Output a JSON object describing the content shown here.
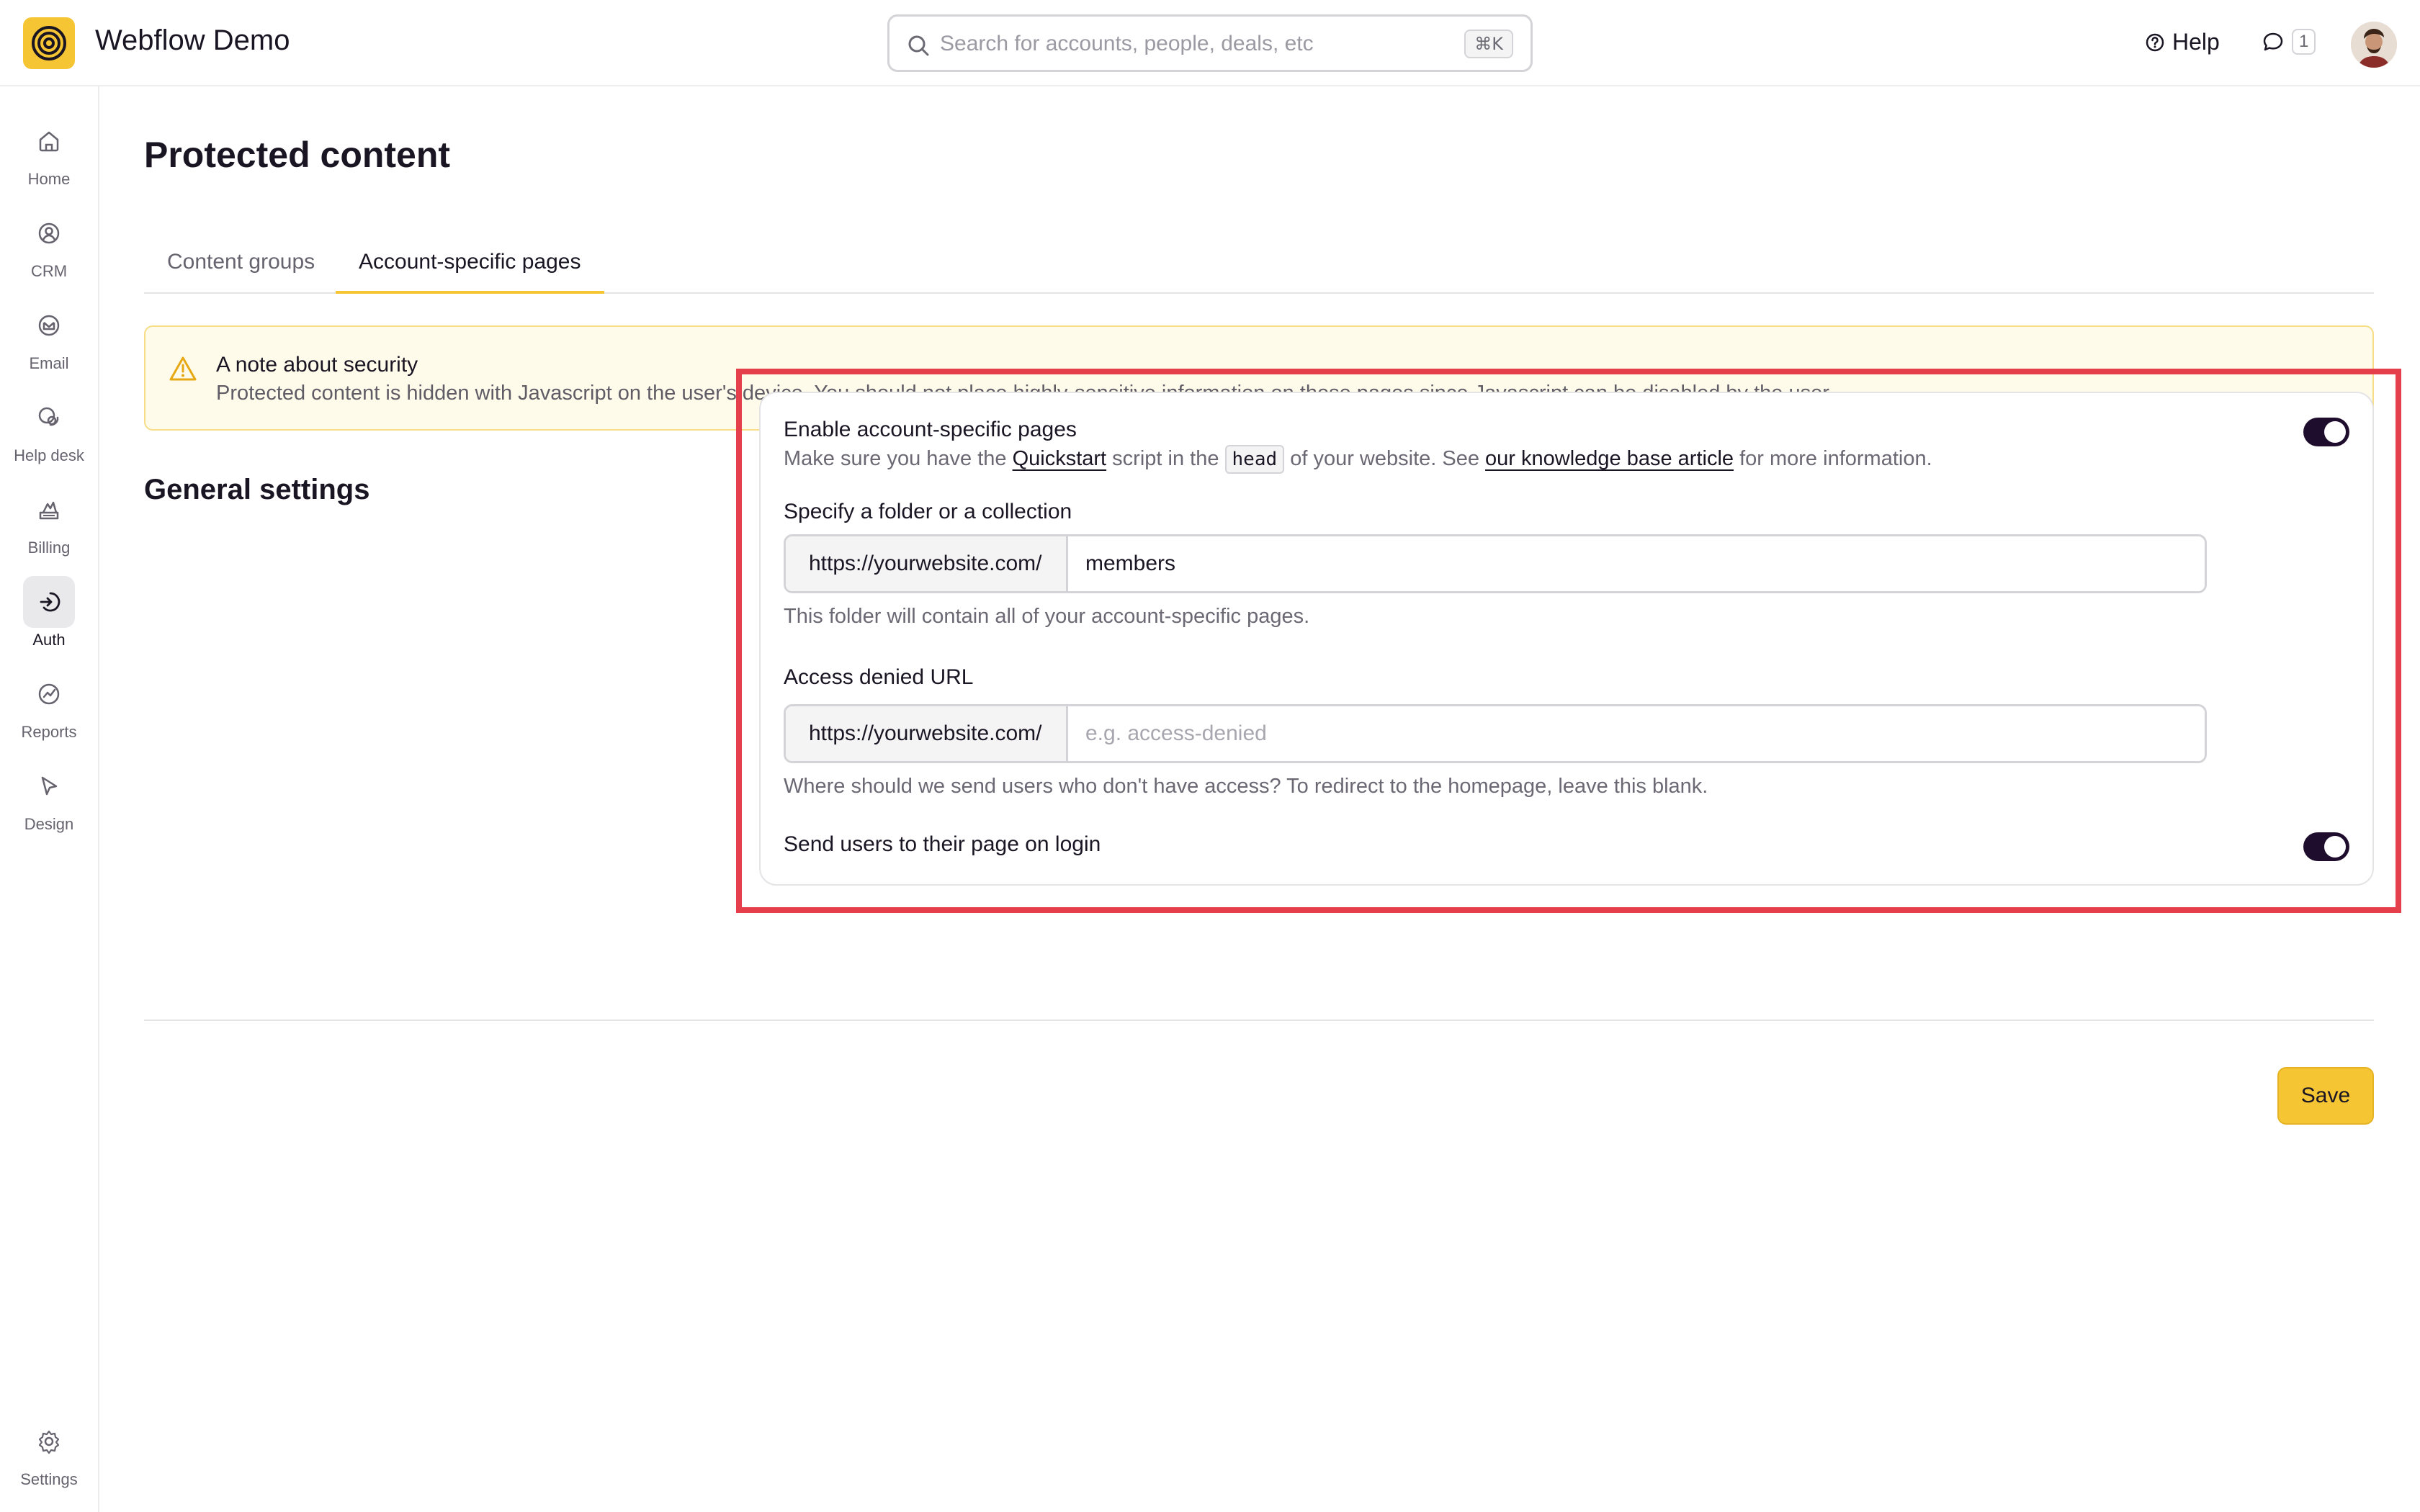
{
  "app": {
    "title": "Webflow Demo"
  },
  "search": {
    "placeholder": "Search for accounts, people, deals, etc",
    "shortcut": "⌘K"
  },
  "header": {
    "help_label": "Help",
    "messages_count": "1"
  },
  "sidebar": {
    "items": [
      {
        "label": "Home",
        "icon": "home-icon"
      },
      {
        "label": "CRM",
        "icon": "contact-icon"
      },
      {
        "label": "Email",
        "icon": "mail-icon"
      },
      {
        "label": "Help desk",
        "icon": "chat-bubbles-icon"
      },
      {
        "label": "Billing",
        "icon": "billing-icon"
      },
      {
        "label": "Auth",
        "icon": "login-icon",
        "active": true
      },
      {
        "label": "Reports",
        "icon": "chart-icon"
      },
      {
        "label": "Design",
        "icon": "cursor-icon"
      }
    ],
    "settings_label": "Settings"
  },
  "page": {
    "title": "Protected content",
    "tabs": [
      {
        "label": "Content groups",
        "active": false
      },
      {
        "label": "Account-specific pages",
        "active": true
      }
    ]
  },
  "alert": {
    "title": "A note about security",
    "text": "Protected content is hidden with Javascript on the user's device. You should not place highly-sensitive information on these pages since Javascript can be disabled by the user."
  },
  "general_settings": {
    "title": "General settings",
    "enable": {
      "label": "Enable account-specific pages",
      "help_prefix": "Make sure you have the",
      "quickstart_link": "Quickstart",
      "help_mid1": "script in the",
      "code": "head",
      "help_mid2": "of your website. See",
      "kb_link": "our knowledge base article",
      "help_suffix": "for more information.",
      "enabled": true
    },
    "folder": {
      "label": "Specify a folder or a collection",
      "prefix": "https://yourwebsite.com/",
      "value": "members",
      "help": "This folder will contain all of your account-specific pages."
    },
    "access_denied": {
      "label": "Access denied URL",
      "prefix": "https://yourwebsite.com/",
      "value": "",
      "placeholder": "e.g. access-denied",
      "help": "Where should we send users who don't have access? To redirect to the homepage, leave this blank."
    },
    "send_on_login": {
      "label": "Send users to their page on login",
      "enabled": true
    }
  },
  "actions": {
    "save_label": "Save"
  },
  "colors": {
    "accent": "#f5c533",
    "toggle_on": "#1f0d2e",
    "highlight": "#e43f4a",
    "alert_bg": "#fffbeb"
  }
}
